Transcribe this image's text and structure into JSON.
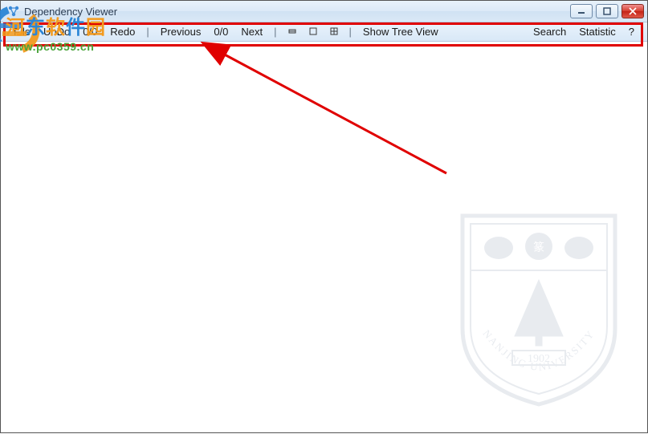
{
  "window": {
    "title": "Dependency Viewer"
  },
  "menubar": {
    "file": "File",
    "undo": "UnDo",
    "undo_counter": "0/0",
    "redo": "Redo",
    "previous": "Previous",
    "nav_counter": "0/0",
    "next": "Next",
    "layout_small": "▫",
    "layout_medium": "▫",
    "layout_grid": "▫",
    "show_tree": "Show Tree View",
    "search": "Search",
    "statistic": "Statistic",
    "help": "?"
  },
  "watermark": {
    "cn": "河东软件园",
    "url": "www.pc0359.cn"
  },
  "shield": {
    "name": "NANJING UNIVERSITY",
    "year": "1902"
  }
}
